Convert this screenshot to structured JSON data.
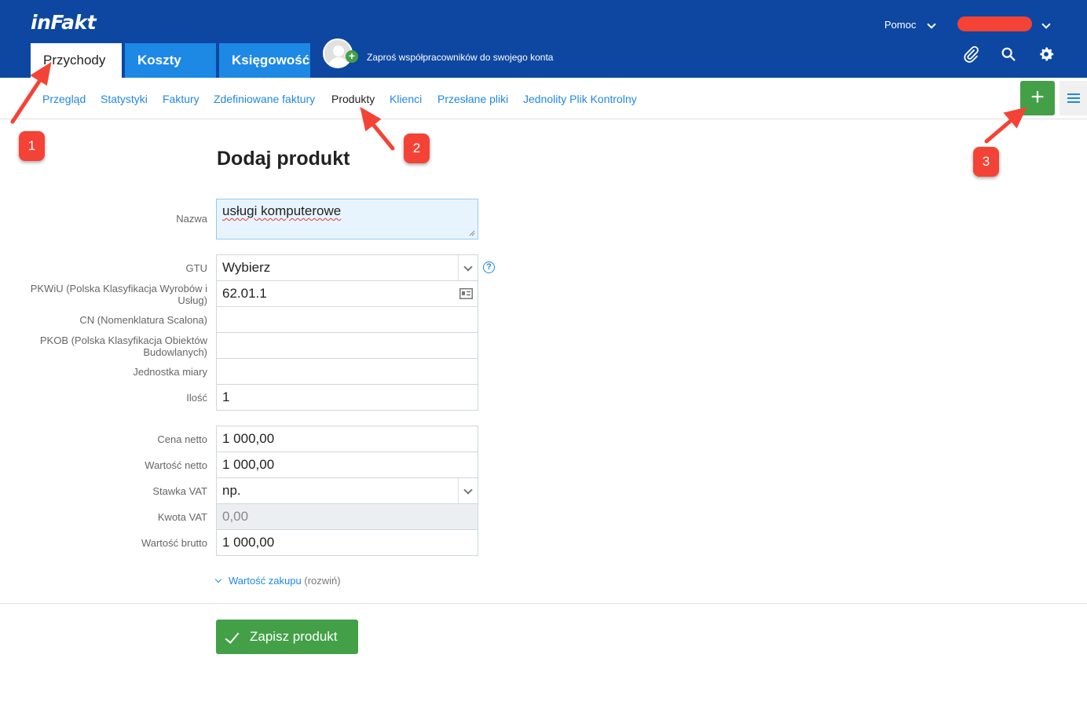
{
  "header": {
    "logo": "inFakt",
    "tabs": [
      {
        "label": "Przychody",
        "active": true
      },
      {
        "label": "Koszty",
        "active": false
      },
      {
        "label": "Księgowość",
        "active": false
      }
    ],
    "invite_text": "Zaproś współpracowników do swojego konta",
    "help_label": "Pomoc",
    "icons": [
      "paperclip-icon",
      "search-icon",
      "gear-icon"
    ]
  },
  "subnav": {
    "items": [
      "Przegląd",
      "Statystyki",
      "Faktury",
      "Zdefiniowane faktury",
      "Produkty",
      "Klienci",
      "Przesłane pliki",
      "Jednolity Plik Kontrolny"
    ],
    "active": "Produkty",
    "add_label": "+"
  },
  "form": {
    "title": "Dodaj produkt",
    "labels": {
      "nazwa": "Nazwa",
      "gtu": "GTU",
      "pkwiu": "PKWiU (Polska Klasyfikacja Wyrobów i Usług)",
      "cn": "CN (Nomenklatura Scalona)",
      "pkob": "PKOB (Polska Klasyfikacja Obiektów Budowlanych)",
      "jednostka": "Jednostka miary",
      "ilosc": "Ilość",
      "cena_netto": "Cena netto",
      "wartosc_netto": "Wartość netto",
      "stawka_vat": "Stawka VAT",
      "kwota_vat": "Kwota VAT",
      "wartosc_brutto": "Wartość brutto"
    },
    "values": {
      "nazwa": "usługi komputerowe",
      "gtu": "Wybierz",
      "pkwiu": "62.01.1",
      "cn": "",
      "pkob": "",
      "jednostka": "",
      "ilosc": "1",
      "cena_netto": "1 000,00",
      "wartosc_netto": "1 000,00",
      "stawka_vat": "np.",
      "kwota_vat": "0,00",
      "wartosc_brutto": "1 000,00"
    },
    "help_glyph": "?",
    "expand_link": "Wartość zakupu",
    "expand_suffix": "(rozwiń)",
    "save_label": "Zapisz produkt"
  },
  "annotations": [
    "1",
    "2",
    "3"
  ],
  "colors": {
    "header_bg": "#0d47a1",
    "tab_bg": "#1e88e5",
    "accent_green": "#43a047",
    "annotation_red": "#f44336",
    "link_blue": "#1e88e5"
  }
}
